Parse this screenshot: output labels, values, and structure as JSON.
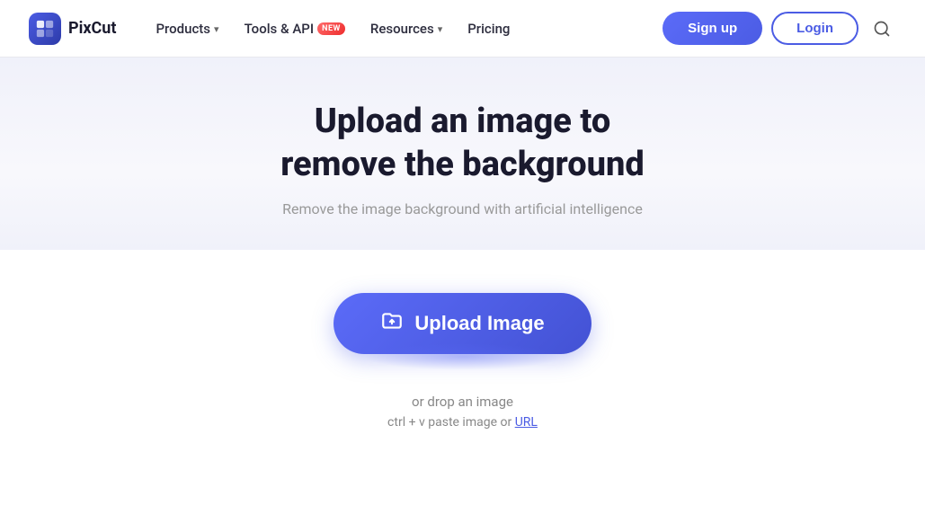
{
  "logo": {
    "name": "PixCut",
    "icon_label": "pixcut-logo"
  },
  "nav": {
    "items": [
      {
        "label": "Products",
        "has_dropdown": true,
        "id": "products"
      },
      {
        "label": "Tools & API",
        "has_dropdown": false,
        "has_badge": true,
        "badge_text": "NEW",
        "id": "tools-api"
      },
      {
        "label": "Resources",
        "has_dropdown": true,
        "id": "resources"
      },
      {
        "label": "Pricing",
        "has_dropdown": false,
        "id": "pricing"
      }
    ],
    "signup_label": "Sign up",
    "login_label": "Login"
  },
  "hero": {
    "title_line1": "Upload an image to",
    "title_line2": "remove the background",
    "subtitle": "Remove the image background with artificial intelligence"
  },
  "upload": {
    "button_label": "Upload Image",
    "drop_text": "or drop an image",
    "paste_text_prefix": "ctrl + v paste image or ",
    "paste_link": "URL"
  }
}
